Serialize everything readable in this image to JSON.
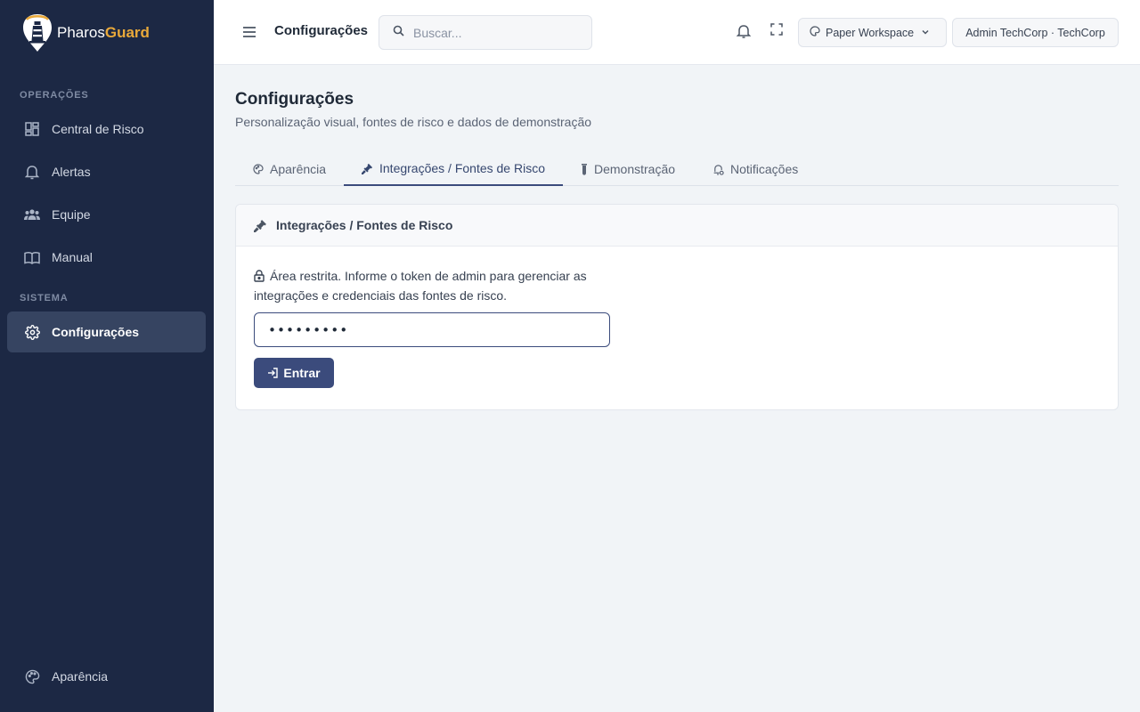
{
  "brand": {
    "name_part1": "Pharos",
    "name_part2": "Guard"
  },
  "sidebar": {
    "section_ops": "OPERAÇÕES",
    "section_system": "SISTEMA",
    "items": [
      {
        "label": "Central de Risco",
        "icon": "dashboard-icon"
      },
      {
        "label": "Alertas",
        "icon": "bell-icon"
      },
      {
        "label": "Equipe",
        "icon": "team-icon"
      },
      {
        "label": "Manual",
        "icon": "book-icon"
      },
      {
        "label": "Configurações",
        "icon": "gear-icon",
        "active": true
      }
    ],
    "bottom_item": {
      "label": "Aparência",
      "icon": "palette-icon"
    }
  },
  "header": {
    "title": "Configurações",
    "search_placeholder": "Buscar...",
    "workspace": "Paper Workspace",
    "user": "Admin TechCorp · TechCorp"
  },
  "main": {
    "title": "Configurações",
    "subtitle": "Personalização visual, fontes de risco e dados de demonstração",
    "tabs": [
      {
        "label": "Aparência",
        "icon": "palette-icon"
      },
      {
        "label": "Integrações / Fontes de Risco",
        "icon": "plug-icon",
        "active": true
      },
      {
        "label": "Demonstração",
        "icon": "test-tube-icon"
      },
      {
        "label": "Notificações",
        "icon": "bell-gear-icon"
      }
    ],
    "card": {
      "title": "Integrações / Fontes de Risco",
      "notice": "Área restrita. Informe o token de admin para gerenciar as integrações e credenciais das fontes de risco.",
      "token_value": "•••••••••",
      "submit_label": "Entrar"
    }
  },
  "colors": {
    "sidebar_bg": "#1c2844",
    "accent": "#3b4b7c",
    "brand_gold": "#e9a93a"
  }
}
